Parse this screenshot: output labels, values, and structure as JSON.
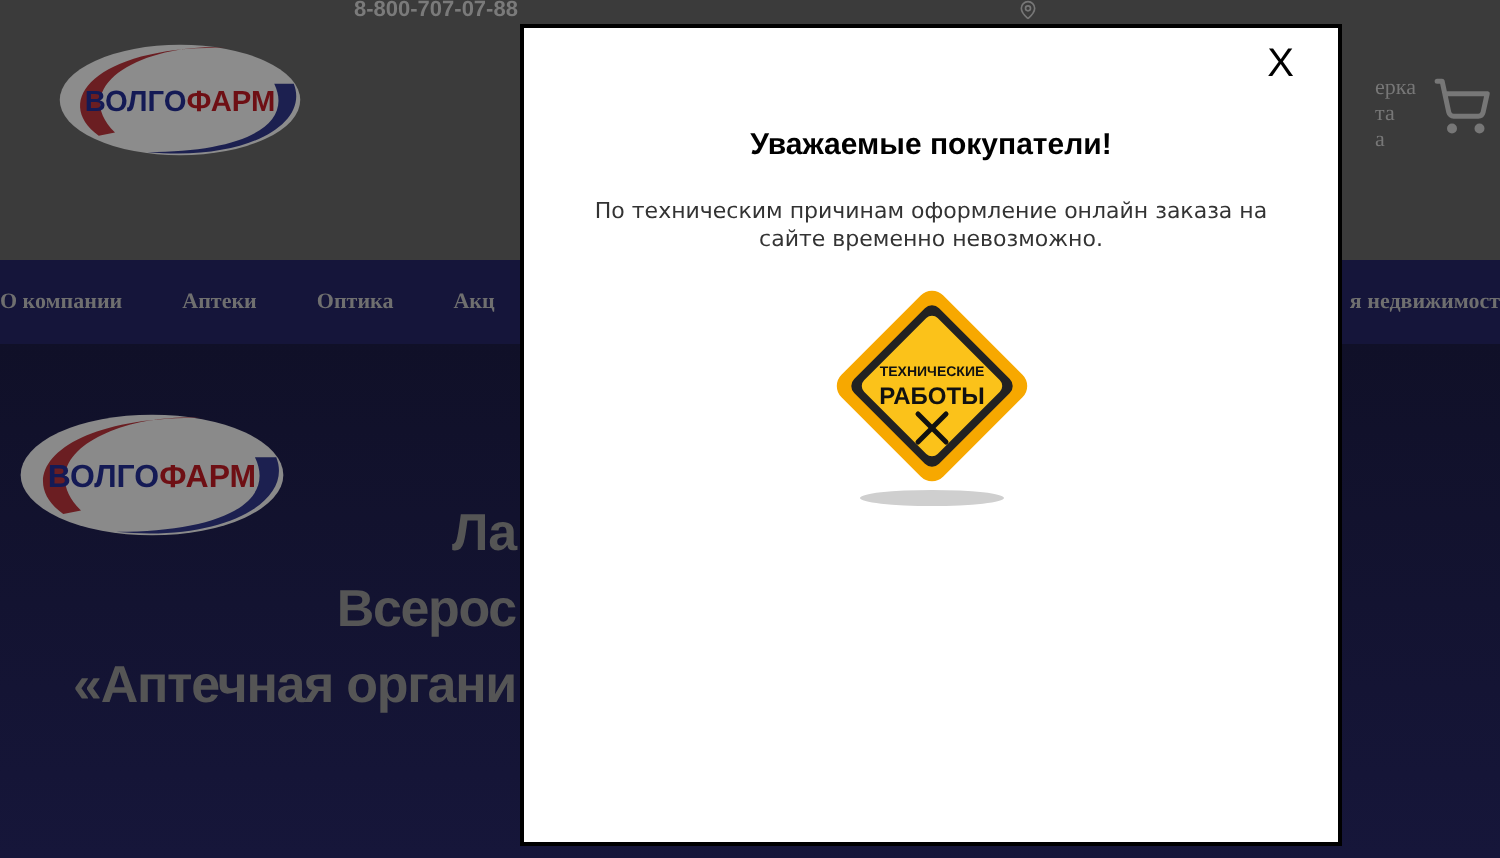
{
  "header": {
    "phone": "8-800-707-07-88",
    "logo": [
      {
        "text": "ВОЛГО",
        "color": "#141a55"
      },
      {
        "text": "ФАРМ",
        "color": "#6e0f14"
      }
    ],
    "side_text": [
      "ерка",
      "та",
      "а"
    ]
  },
  "nav": {
    "items": [
      "О компании",
      "Аптеки",
      "Оптика",
      "Акц"
    ],
    "item_right": "я недвижимост"
  },
  "banner": {
    "logo": [
      {
        "text": "ВОЛГО",
        "color": "#141a55"
      },
      {
        "text": "ФАРМ",
        "color": "#6e0f14"
      }
    ],
    "lines": [
      "Ла",
      "Всерос",
      "«Аптечная органи"
    ]
  },
  "modal": {
    "close": "X",
    "title": "Уважаемые покупатели!",
    "message": "По техническим причинам оформление онлайн заказа на сайте временно невозможно.",
    "sign": [
      "ТЕХНИЧЕСКИЕ",
      "РАБОТЫ"
    ]
  }
}
